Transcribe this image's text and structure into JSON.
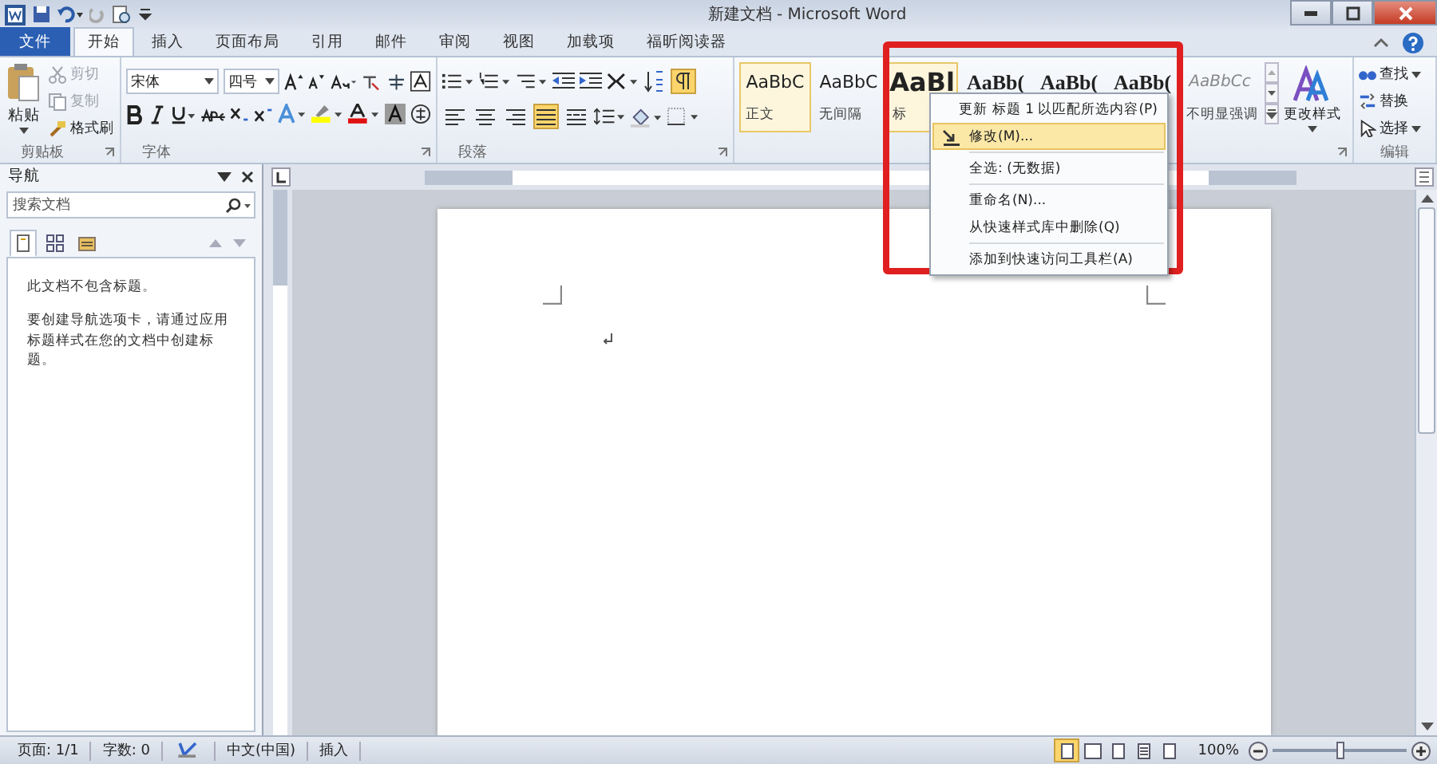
{
  "window": {
    "title": "新建文档 - Microsoft Word"
  },
  "tabs": [
    {
      "label": "文件",
      "kind": "file",
      "selected": false
    },
    {
      "label": "开始",
      "kind": "tab",
      "selected": true
    },
    {
      "label": "插入",
      "kind": "tab",
      "selected": false
    },
    {
      "label": "页面布局",
      "kind": "tab",
      "selected": false
    },
    {
      "label": "引用",
      "kind": "tab",
      "selected": false
    },
    {
      "label": "邮件",
      "kind": "tab",
      "selected": false
    },
    {
      "label": "审阅",
      "kind": "tab",
      "selected": false
    },
    {
      "label": "视图",
      "kind": "tab",
      "selected": false
    },
    {
      "label": "加载项",
      "kind": "tab",
      "selected": false
    },
    {
      "label": "福昕阅读器",
      "kind": "tab",
      "selected": false
    }
  ],
  "clipboard": {
    "group": "剪贴板",
    "paste": "粘贴",
    "items": [
      {
        "label": "剪切",
        "disabled": true
      },
      {
        "label": "复制",
        "disabled": true
      },
      {
        "label": "格式刷",
        "disabled": false
      }
    ]
  },
  "font": {
    "group": "字体",
    "name": "宋体",
    "size": "四号"
  },
  "paragraph": {
    "group": "段落",
    "align": [
      {
        "selected": false
      },
      {
        "selected": false
      },
      {
        "selected": false
      },
      {
        "selected": true
      },
      {
        "selected": false
      }
    ],
    "show_marks": {
      "selected": true
    }
  },
  "styles": {
    "items": [
      {
        "preview": "AaBbC",
        "label": "正文",
        "kind": "normal",
        "selected": true
      },
      {
        "preview": "AaBbC",
        "label": "无间隔",
        "kind": "normal",
        "selected": false
      },
      {
        "preview": "AaBl",
        "label": "标",
        "kind": "title",
        "selected": true
      },
      {
        "preview": "AaBb(",
        "kind": "heading",
        "selected": false
      },
      {
        "preview": "AaBb(",
        "kind": "heading",
        "selected": false
      },
      {
        "preview": "AaBb(",
        "kind": "heading",
        "selected": false
      },
      {
        "preview": "AaBbCc",
        "label": "不明显强调",
        "kind": "emphasis",
        "selected": false
      }
    ],
    "change": "更改样式"
  },
  "editing": {
    "group": "编辑",
    "items": [
      "查找",
      "替换",
      "选择"
    ]
  },
  "context_menu": [
    {
      "label": "更新 标题 1 以匹配所选内容(P)",
      "separator_before": false,
      "selected": false
    },
    {
      "label": "修改(M)...",
      "separator_before": false,
      "selected": true
    },
    {
      "label": "全选: (无数据)",
      "separator_before": true,
      "selected": false
    },
    {
      "label": "重命名(N)...",
      "separator_before": true,
      "selected": false
    },
    {
      "label": "从快速样式库中删除(Q)",
      "separator_before": false,
      "selected": false
    },
    {
      "label": "添加到快速访问工具栏(A)",
      "separator_before": true,
      "selected": false
    }
  ],
  "navigation": {
    "title": "导航",
    "search": {
      "placeholder": "搜索文档"
    },
    "views": [
      {
        "selected": true
      },
      {
        "selected": false
      },
      {
        "selected": false
      }
    ],
    "messages": [
      "此文档不包含标题。",
      "要创建导航选项卡，请通过应用标题样式在您的文档中创建标题。"
    ]
  },
  "status_bar": {
    "items": [
      "页面: 1/1",
      "字数: 0",
      "中文(中国)",
      "插入"
    ],
    "views": [
      {
        "selected": true
      },
      {
        "selected": false
      },
      {
        "selected": false
      },
      {
        "selected": false
      },
      {
        "selected": false
      }
    ],
    "zoom": "100%",
    "level": 0.5
  }
}
